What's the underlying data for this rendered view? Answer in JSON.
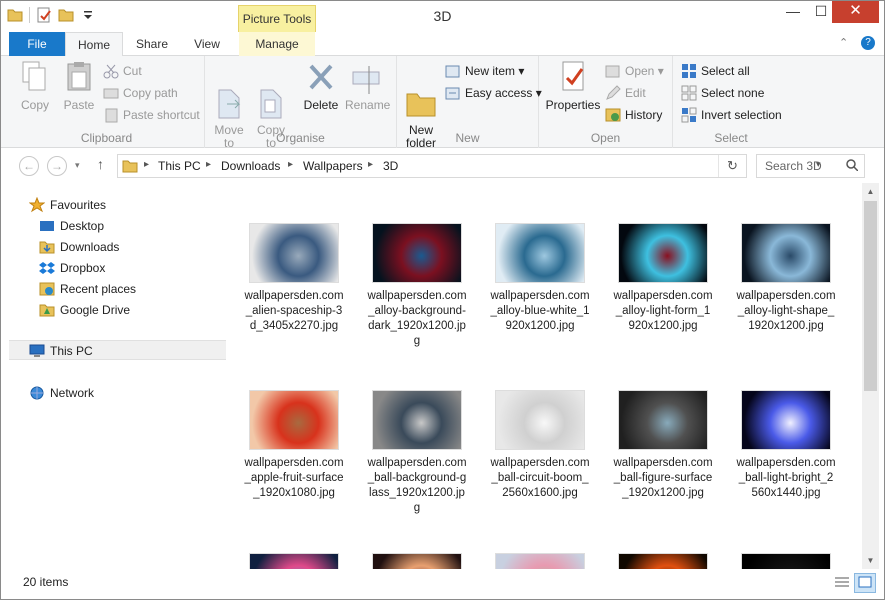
{
  "window": {
    "title": "3D",
    "contextual_tab_group": "Picture Tools",
    "min_symbol": "—",
    "max_symbol": "☐",
    "close_symbol": "✕"
  },
  "tabs": [
    "File",
    "Home",
    "Share",
    "View",
    "Manage"
  ],
  "tab_right": {
    "minimize_ribbon": "⌃",
    "help": "?"
  },
  "ribbon": {
    "clipboard": {
      "label": "Clipboard",
      "copy": "Copy",
      "paste": "Paste",
      "cut": "Cut",
      "copy_path": "Copy path",
      "paste_shortcut": "Paste shortcut"
    },
    "organise": {
      "label": "Organise",
      "move_to": "Move\nto",
      "copy_to": "Copy\nto",
      "delete": "Delete",
      "rename": "Rename"
    },
    "new": {
      "label": "New",
      "new_folder": "New\nfolder",
      "new_item": "New item ▾",
      "easy_access": "Easy access ▾"
    },
    "open": {
      "label": "Open",
      "properties": "Properties",
      "open": "Open ▾",
      "edit": "Edit",
      "history": "History"
    },
    "select": {
      "label": "Select",
      "select_all": "Select all",
      "select_none": "Select none",
      "invert_selection": "Invert selection"
    }
  },
  "address": {
    "back": "←",
    "forward": "→",
    "up": "↑",
    "crumbs": [
      "This PC",
      "Downloads",
      "Wallpapers",
      "3D"
    ],
    "refresh": "↻",
    "search_placeholder": "Search 3D"
  },
  "nav": {
    "favourites_label": "Favourites",
    "favourites": [
      "Desktop",
      "Downloads",
      "Dropbox",
      "Recent places",
      "Google Drive"
    ],
    "this_pc": "This PC",
    "network": "Network"
  },
  "files": [
    {
      "name": "wallpapersden.com_alien-spaceship-3d_3405x2270.jpg",
      "thumb": [
        "#e8e8e8",
        "#3a5a80",
        "#9ab"
      ]
    },
    {
      "name": "wallpapersden.com_alloy-background-dark_1920x1200.jpg",
      "thumb": [
        "#05121e",
        "#7b1020",
        "#1a5a90"
      ]
    },
    {
      "name": "wallpapersden.com_alloy-blue-white_1920x1200.jpg",
      "thumb": [
        "#e0ecf4",
        "#2a6a90",
        "#9ec8e0"
      ]
    },
    {
      "name": "wallpapersden.com_alloy-light-form_1920x1200.jpg",
      "thumb": [
        "#03080f",
        "#3ec0e0",
        "#8a1020"
      ]
    },
    {
      "name": "wallpapersden.com_alloy-light-shape_1920x1200.jpg",
      "thumb": [
        "#0a1420",
        "#8ab8d8",
        "#2a4a68"
      ]
    },
    {
      "name": "wallpapersden.com_apple-fruit-surface_1920x1080.jpg",
      "thumb": [
        "#f2c8a8",
        "#d8321c",
        "#a86a40"
      ]
    },
    {
      "name": "wallpapersden.com_ball-background-glass_1920x1200.jpg",
      "thumb": [
        "#888",
        "#3a4a5a",
        "#c8c8c8"
      ]
    },
    {
      "name": "wallpapersden.com_ball-circuit-boom_2560x1600.jpg",
      "thumb": [
        "#e8e8e8",
        "#d0d0d0",
        "#f8f8f8"
      ]
    },
    {
      "name": "wallpapersden.com_ball-figure-surface_1920x1200.jpg",
      "thumb": [
        "#202020",
        "#505050",
        "#8ab"
      ]
    },
    {
      "name": "wallpapersden.com_ball-light-bright_2560x1440.jpg",
      "thumb": [
        "#05051a",
        "#4a5ae8",
        "#f0f0ff"
      ]
    },
    {
      "name": "",
      "thumb": [
        "#102040",
        "#e04a8a",
        "#4aa0e0"
      ]
    },
    {
      "name": "",
      "thumb": [
        "#201010",
        "#e8a070",
        "#502030"
      ]
    },
    {
      "name": "",
      "thumb": [
        "#c8d0e0",
        "#e89ab0",
        "#8ad0a0"
      ]
    },
    {
      "name": "",
      "thumb": [
        "#100800",
        "#e05010",
        "#301800"
      ]
    },
    {
      "name": "",
      "thumb": [
        "#000000",
        "#101010",
        "#202020"
      ]
    }
  ],
  "status": {
    "item_count": "20 items"
  },
  "colors": {
    "file_tab": "#1979ca",
    "close_button": "#c7402e",
    "picture_tools": "#f8f0a0"
  }
}
